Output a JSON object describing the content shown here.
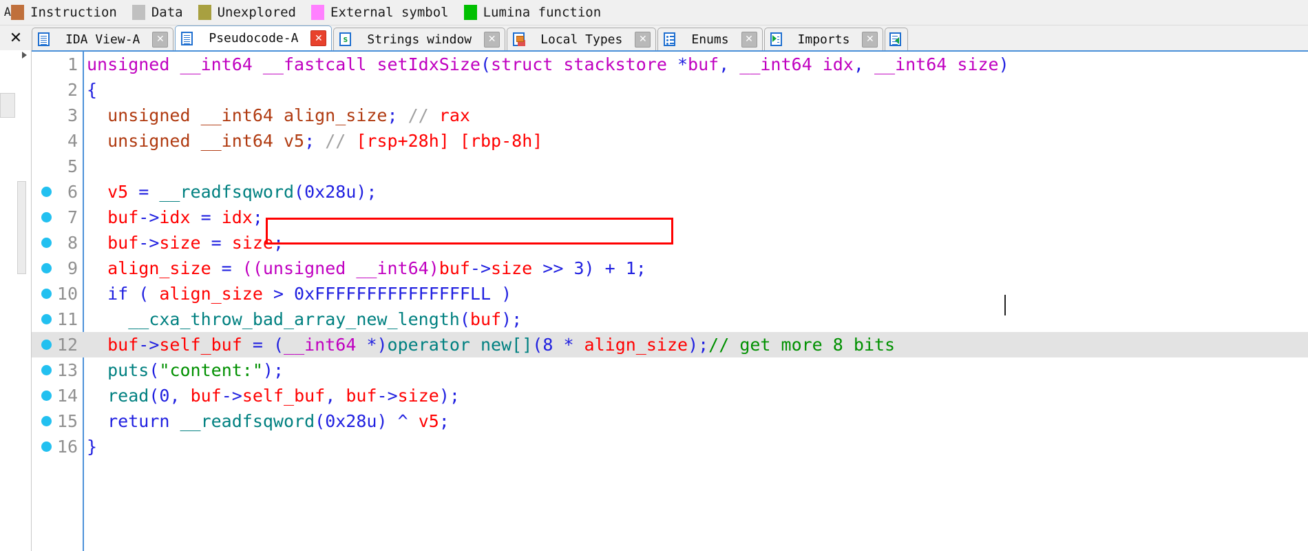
{
  "legend": {
    "lead_glyph": "A",
    "items": [
      {
        "label": "Instruction",
        "color": "#c0703c",
        "icon": "color-swatch"
      },
      {
        "label": "Data",
        "color": "#c0c0c0",
        "icon": "color-swatch"
      },
      {
        "label": "Unexplored",
        "color": "#a8a040",
        "icon": "color-swatch"
      },
      {
        "label": "External symbol",
        "color": "#ff80ff",
        "icon": "color-swatch"
      },
      {
        "label": "Lumina function",
        "color": "#00c000",
        "icon": "color-swatch"
      }
    ]
  },
  "tabbar": {
    "close_all_label": "✕",
    "close_glyph": "✕",
    "tabs": [
      {
        "label": "IDA View-A",
        "icon": "document-icon",
        "active": false,
        "close_hot": false
      },
      {
        "label": "Pseudocode-A",
        "icon": "document-icon",
        "active": true,
        "close_hot": true
      },
      {
        "label": "Strings window",
        "icon": "strings-icon",
        "active": false,
        "close_hot": false
      },
      {
        "label": "Local Types",
        "icon": "local-types-icon",
        "active": false,
        "close_hot": false
      },
      {
        "label": "Enums",
        "icon": "enums-icon",
        "active": false,
        "close_hot": false
      },
      {
        "label": "Imports",
        "icon": "imports-icon",
        "active": false,
        "close_hot": false
      }
    ],
    "overflow_icon": "exports-icon"
  },
  "code": {
    "current_line": 12,
    "lines": [
      {
        "n": "1",
        "bp": false,
        "tokens": [
          {
            "t": "unsigned __int64 __fastcall ",
            "c": "t-kw"
          },
          {
            "t": "setIdxSize",
            "c": "t-fn"
          },
          {
            "t": "(",
            "c": "t-blue"
          },
          {
            "t": "struct stackstore ",
            "c": "t-kw"
          },
          {
            "t": "*",
            "c": "t-blue"
          },
          {
            "t": "buf",
            "c": "t-kw"
          },
          {
            "t": ", ",
            "c": "t-blue"
          },
          {
            "t": "__int64 ",
            "c": "t-kw"
          },
          {
            "t": "idx",
            "c": "t-kw"
          },
          {
            "t": ", ",
            "c": "t-blue"
          },
          {
            "t": "__int64 ",
            "c": "t-kw"
          },
          {
            "t": "size",
            "c": "t-kw"
          },
          {
            "t": ")",
            "c": "t-blue"
          }
        ]
      },
      {
        "n": "2",
        "bp": false,
        "tokens": [
          {
            "t": "{",
            "c": "t-blue"
          }
        ]
      },
      {
        "n": "3",
        "bp": false,
        "tokens": [
          {
            "t": "  unsigned __int64 align_size",
            "c": "t-brn"
          },
          {
            "t": ";",
            "c": "t-blue"
          },
          {
            "t": " ",
            "c": "t-blk"
          },
          {
            "t": "//",
            "c": "t-gry"
          },
          {
            "t": " ",
            "c": "t-blk"
          },
          {
            "t": "rax",
            "c": "t-red"
          }
        ]
      },
      {
        "n": "4",
        "bp": false,
        "tokens": [
          {
            "t": "  unsigned __int64 v5",
            "c": "t-brn"
          },
          {
            "t": ";",
            "c": "t-blue"
          },
          {
            "t": " ",
            "c": "t-blk"
          },
          {
            "t": "//",
            "c": "t-gry"
          },
          {
            "t": " ",
            "c": "t-blk"
          },
          {
            "t": "[rsp+28h] [rbp-8h]",
            "c": "t-red"
          }
        ]
      },
      {
        "n": "5",
        "bp": false,
        "tokens": [
          {
            "t": "",
            "c": "t-blk"
          }
        ]
      },
      {
        "n": "6",
        "bp": true,
        "tokens": [
          {
            "t": "  ",
            "c": "t-blk"
          },
          {
            "t": "v5",
            "c": "t-red"
          },
          {
            "t": " = ",
            "c": "t-blue"
          },
          {
            "t": "__readfsqword",
            "c": "t-teal"
          },
          {
            "t": "(",
            "c": "t-blue"
          },
          {
            "t": "0x28u",
            "c": "t-blue"
          },
          {
            "t": ");",
            "c": "t-blue"
          }
        ]
      },
      {
        "n": "7",
        "bp": true,
        "tokens": [
          {
            "t": "  ",
            "c": "t-blk"
          },
          {
            "t": "buf",
            "c": "t-red"
          },
          {
            "t": "->",
            "c": "t-blue"
          },
          {
            "t": "idx",
            "c": "t-red"
          },
          {
            "t": " = ",
            "c": "t-blue"
          },
          {
            "t": "idx",
            "c": "t-red"
          },
          {
            "t": ";",
            "c": "t-blue"
          }
        ]
      },
      {
        "n": "8",
        "bp": true,
        "tokens": [
          {
            "t": "  ",
            "c": "t-blk"
          },
          {
            "t": "buf",
            "c": "t-red"
          },
          {
            "t": "->",
            "c": "t-blue"
          },
          {
            "t": "size",
            "c": "t-red"
          },
          {
            "t": " = ",
            "c": "t-blue"
          },
          {
            "t": "size",
            "c": "t-red"
          },
          {
            "t": ";",
            "c": "t-blue"
          }
        ]
      },
      {
        "n": "9",
        "bp": true,
        "tokens": [
          {
            "t": "  ",
            "c": "t-blk"
          },
          {
            "t": "align_size",
            "c": "t-red"
          },
          {
            "t": " = ",
            "c": "t-blue"
          },
          {
            "t": "((unsigned __int64)",
            "c": "t-kw"
          },
          {
            "t": "buf",
            "c": "t-red"
          },
          {
            "t": "->",
            "c": "t-blue"
          },
          {
            "t": "size",
            "c": "t-red"
          },
          {
            "t": " >> 3) + 1;",
            "c": "t-blue"
          }
        ]
      },
      {
        "n": "10",
        "bp": true,
        "tokens": [
          {
            "t": "  ",
            "c": "t-blk"
          },
          {
            "t": "if ( ",
            "c": "t-blue"
          },
          {
            "t": "align_size",
            "c": "t-red"
          },
          {
            "t": " > ",
            "c": "t-blue"
          },
          {
            "t": "0xFFFFFFFFFFFFFFFLL",
            "c": "t-blue"
          },
          {
            "t": " )",
            "c": "t-blue"
          }
        ]
      },
      {
        "n": "11",
        "bp": true,
        "tokens": [
          {
            "t": "    ",
            "c": "t-blk"
          },
          {
            "t": "__cxa_throw_bad_array_new_length",
            "c": "t-teal"
          },
          {
            "t": "(",
            "c": "t-blue"
          },
          {
            "t": "buf",
            "c": "t-red"
          },
          {
            "t": ");",
            "c": "t-blue"
          }
        ]
      },
      {
        "n": "12",
        "bp": true,
        "tokens": [
          {
            "t": "  ",
            "c": "t-blk"
          },
          {
            "t": "buf",
            "c": "t-red"
          },
          {
            "t": "->",
            "c": "t-blue"
          },
          {
            "t": "self_buf",
            "c": "t-red"
          },
          {
            "t": " = (",
            "c": "t-blue"
          },
          {
            "t": "__int64 ",
            "c": "t-kw"
          },
          {
            "t": "*)",
            "c": "t-blue"
          },
          {
            "t": "operator new[]",
            "c": "t-teal"
          },
          {
            "t": "(",
            "c": "t-blue"
          },
          {
            "t": "8",
            "c": "t-blue"
          },
          {
            "t": " * ",
            "c": "t-blue"
          },
          {
            "t": "align_size",
            "c": "t-red"
          },
          {
            "t": ");",
            "c": "t-blue"
          },
          {
            "t": "// get more 8 bits",
            "c": "t-grn"
          }
        ]
      },
      {
        "n": "13",
        "bp": true,
        "tokens": [
          {
            "t": "  ",
            "c": "t-blk"
          },
          {
            "t": "puts",
            "c": "t-teal"
          },
          {
            "t": "(",
            "c": "t-blue"
          },
          {
            "t": "\"content:\"",
            "c": "t-grn"
          },
          {
            "t": ");",
            "c": "t-blue"
          }
        ]
      },
      {
        "n": "14",
        "bp": true,
        "tokens": [
          {
            "t": "  ",
            "c": "t-blk"
          },
          {
            "t": "read",
            "c": "t-teal"
          },
          {
            "t": "(",
            "c": "t-blue"
          },
          {
            "t": "0",
            "c": "t-blue"
          },
          {
            "t": ", ",
            "c": "t-blue"
          },
          {
            "t": "buf",
            "c": "t-red"
          },
          {
            "t": "->",
            "c": "t-blue"
          },
          {
            "t": "self_buf",
            "c": "t-red"
          },
          {
            "t": ", ",
            "c": "t-blue"
          },
          {
            "t": "buf",
            "c": "t-red"
          },
          {
            "t": "->",
            "c": "t-blue"
          },
          {
            "t": "size",
            "c": "t-red"
          },
          {
            "t": ");",
            "c": "t-blue"
          }
        ]
      },
      {
        "n": "15",
        "bp": true,
        "tokens": [
          {
            "t": "  ",
            "c": "t-blk"
          },
          {
            "t": "return ",
            "c": "t-blue"
          },
          {
            "t": "__readfsqword",
            "c": "t-teal"
          },
          {
            "t": "(",
            "c": "t-blue"
          },
          {
            "t": "0x28u",
            "c": "t-blue"
          },
          {
            "t": ")",
            "c": "t-blue"
          },
          {
            "t": " ^ ",
            "c": "t-blue"
          },
          {
            "t": "v5",
            "c": "t-red"
          },
          {
            "t": ";",
            "c": "t-blue"
          }
        ]
      },
      {
        "n": "16",
        "bp": true,
        "tokens": [
          {
            "t": "}",
            "c": "t-blue"
          }
        ]
      }
    ]
  },
  "annotation": {
    "highlight_rect_color": "#ff0000",
    "highlight_target_line": "9",
    "highlight_text": "((unsigned __int64)buf->size >> 3) + 1;"
  },
  "colors": {
    "accent_blue": "#4a90d9",
    "breakpoint": "#22c0f0",
    "current_line_bg": "#e3e3e3",
    "chrome_bg": "#f0f0f0"
  }
}
